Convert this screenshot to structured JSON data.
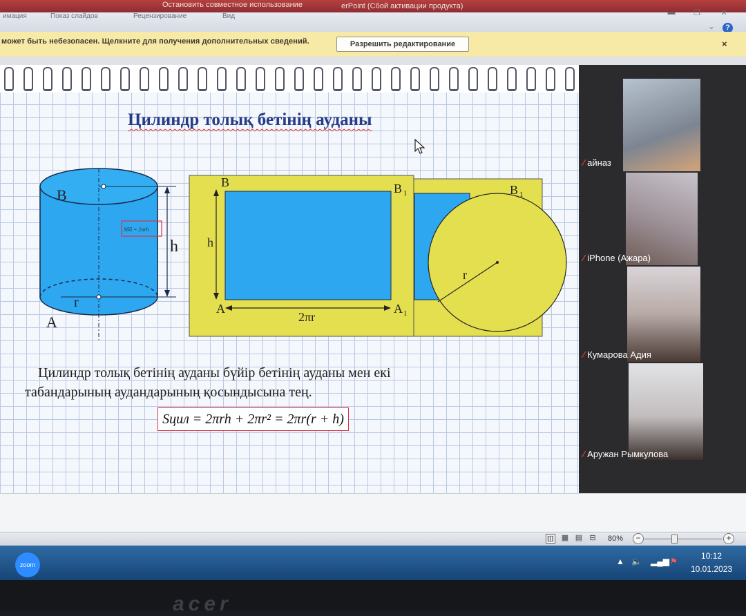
{
  "window": {
    "title_left": "Остановить совместное использование",
    "title_right": "erPoint (Сбой активации продукта)"
  },
  "ribbon": {
    "tabs": [
      "имация",
      "Показ слайдов",
      "Рецензирование",
      "Вид"
    ]
  },
  "message_bar": {
    "text": "может быть небезопасен. Щелкните для получения дополнительных сведений.",
    "button": "Разрешить редактирование",
    "close": "×"
  },
  "slide": {
    "title": "Цилиндр толық бетінің ауданы",
    "paragraph": "Цилиндр толық бетінің ауданы бүйір бетінің ауданы мен екі табандарының аудандарының қосындысына тең.",
    "formula": "Sцил = 2πrh + 2πr² = 2πr(r + h)",
    "figure_labels": {
      "cyl_B": "B",
      "cyl_A": "A",
      "cyl_r": "r",
      "cyl_h": "h",
      "cyl_box": "Sбб = 2πrh",
      "net_B": "B",
      "net_B1": "B",
      "net_B1_sub": "1",
      "net_B1b": "B",
      "net_B1b_sub": "1",
      "net_h": "h",
      "net_A": "A",
      "net_A1": "A",
      "net_A1_sub": "1",
      "net_2pr": "2πr",
      "net_r": "r"
    }
  },
  "participants": [
    {
      "name": "айназ"
    },
    {
      "name": "iPhone (Ажара)"
    },
    {
      "name": "Кумарова Адия"
    },
    {
      "name": "Аружан Рымкулова"
    }
  ],
  "status": {
    "zoom": "80%",
    "minus": "−",
    "plus": "+"
  },
  "taskbar": {
    "app": "zoom",
    "time": "10:12",
    "date": "10.01.2023"
  },
  "bezel": {
    "brand": "acer"
  },
  "colors": {
    "accent_blue": "#2da7ef",
    "yellow": "#e4df4e",
    "title_blue": "#253c88",
    "formula_border": "#d9334b"
  }
}
